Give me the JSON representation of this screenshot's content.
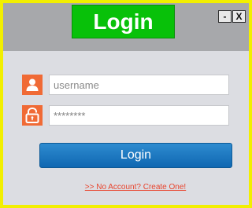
{
  "window": {
    "title": "Login",
    "minimize_label": "-",
    "close_label": "X"
  },
  "form": {
    "username_icon": "user-icon",
    "username_placeholder": "username",
    "password_icon": "unlock-icon",
    "password_value": "********",
    "login_label": "Login",
    "create_account_link": ">> No Account? Create One!"
  },
  "colors": {
    "border": "#f2ef00",
    "titlebar": "#a7a8ab",
    "title_box": "#08c109",
    "body": "#dcdde2",
    "icon_bg": "#f06a35",
    "login_button": "#1a73bd",
    "link": "#e8442d"
  }
}
